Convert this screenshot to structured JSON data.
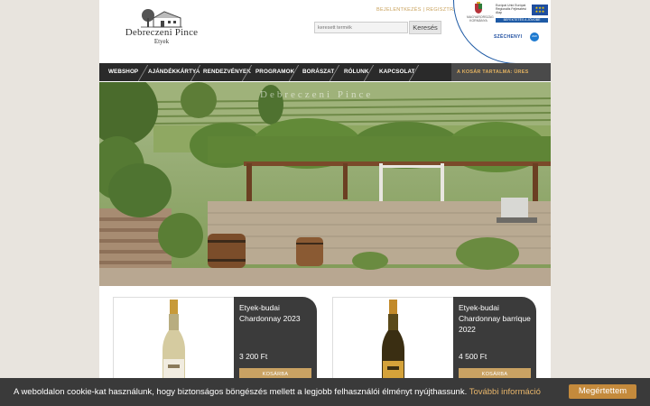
{
  "brand": {
    "name": "Debreczeni Pince",
    "subtitle": "Etyek",
    "hero_overlay": "Debreczeni Pince"
  },
  "header": {
    "login": "BEJELENTKEZÉS",
    "separator": "|",
    "register": "REGISZTRÁCIÓ",
    "search_placeholder": "keresett termék",
    "search_button": "Keresés",
    "eu_fund_text": "Európai Unió Európai Regionális Fejlesztési Alap",
    "eu_gov_text": "MAGYARORSZÁG KORMÁNYA",
    "eu_bar": "BEFEKTETÉS A JÖVŐBE",
    "szechenyi": "SZÉCHENYI",
    "szechenyi_num": "2020"
  },
  "nav": {
    "items": [
      "WEBSHOP",
      "AJÁNDÉKKÁRTYA",
      "RENDEZVÉNYEK",
      "PROGRAMOK",
      "BORÁSZAT",
      "RÓLUNK",
      "KAPCSOLAT"
    ],
    "cart": "A KOSÁR TARTALMA: ÜRES"
  },
  "products": [
    {
      "name": "Etyek-budai Chardonnay 2023",
      "price": "3 200 Ft",
      "button": "KOSÁRBA"
    },
    {
      "name": "Etyek-budai Chardonnay barrique 2022",
      "price": "4 500 Ft",
      "button": "KOSÁRBA"
    }
  ],
  "cookie": {
    "text": "A weboldalon cookie-kat használunk, hogy biztonságos böngészés mellett a legjobb felhasználói élményt nyújthassunk.",
    "more": "További információ",
    "accept": "Megértettem"
  }
}
